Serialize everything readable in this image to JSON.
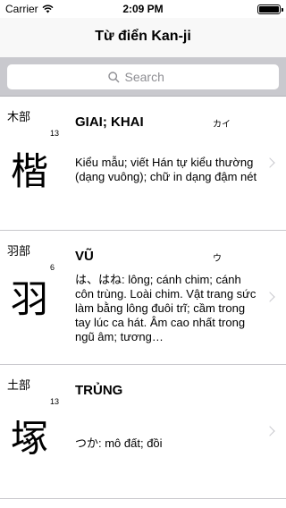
{
  "status_bar": {
    "carrier": "Carrier",
    "time": "2:09 PM",
    "battery_level": 1.0
  },
  "nav": {
    "title": "Từ điển Kan-ji"
  },
  "search": {
    "placeholder": "Search"
  },
  "entries": [
    {
      "radical": "木部",
      "strokes": "13",
      "kanji": "楷",
      "reading": "GIAI; KHAI",
      "kana": "カイ",
      "meaning": "Kiểu mẫu; viết Hán tự kiểu thường (dạng vuông); chữ in dạng đậm nét"
    },
    {
      "radical": "羽部",
      "strokes": "6",
      "kanji": "羽",
      "reading": "VŨ",
      "kana": "ウ",
      "meaning": "は、はね: lông; cánh chim; cánh côn trùng.  Loài chim. Vật trang sức làm bằng lông đuôi trĩ; cầm trong tay lúc ca hát. Âm cao nhất trong ngũ âm; tương…"
    },
    {
      "radical": "土部",
      "strokes": "13",
      "kanji": "塚",
      "reading": "TRỦNG",
      "kana": "",
      "meaning": "つか: mô đất; đồi"
    }
  ]
}
